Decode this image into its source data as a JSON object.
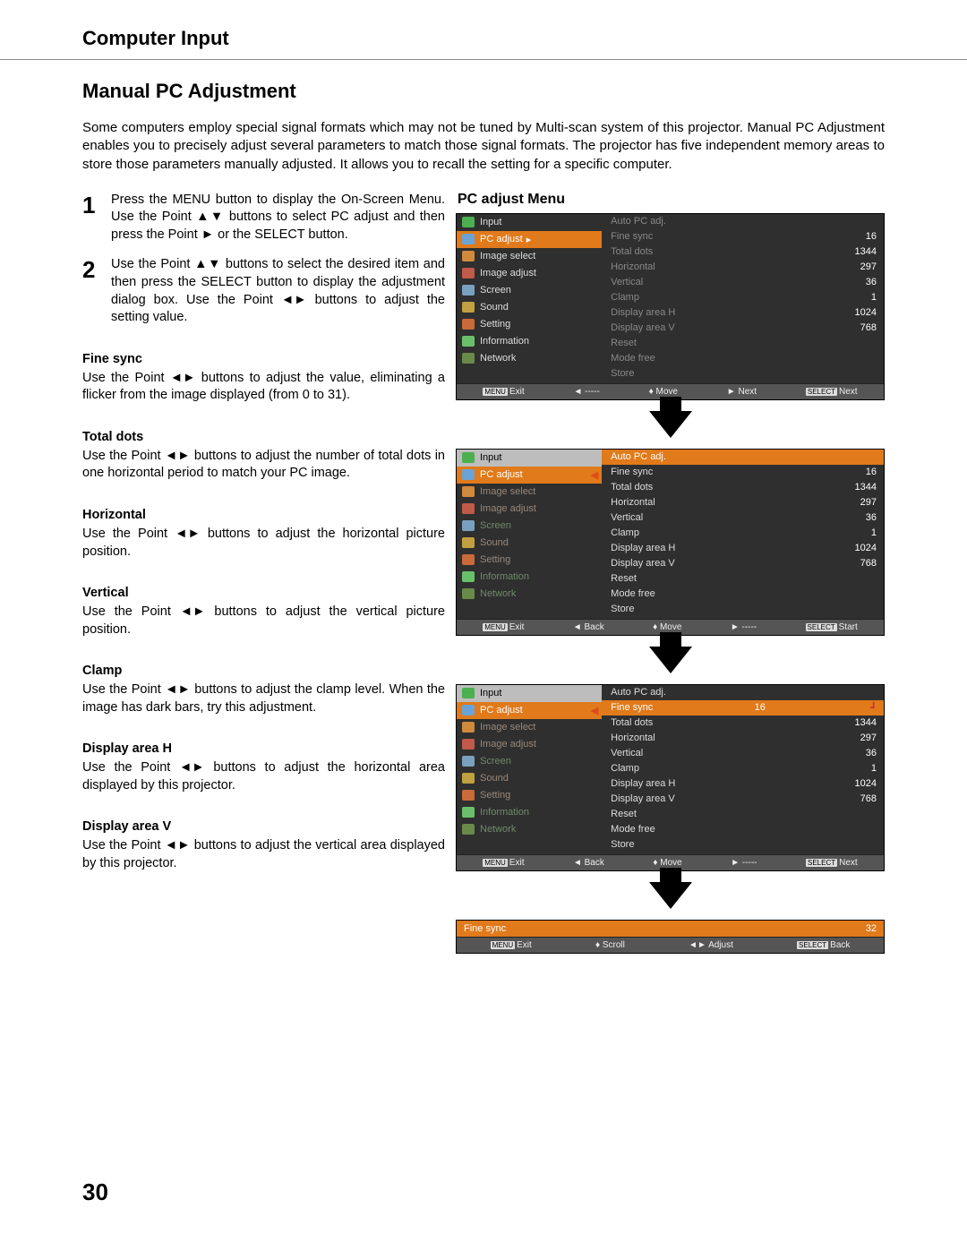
{
  "header": {
    "section": "Computer Input",
    "title": "Manual PC Adjustment"
  },
  "intro": "Some computers employ special signal formats which may not be tuned by Multi-scan system of this projector. Manual PC Adjustment enables you to precisely adjust several parameters to match those signal formats. The projector has five independent memory areas to store those parameters manually adjusted. It allows you to recall the setting for a specific computer.",
  "steps": [
    {
      "num": "1",
      "text": "Press the MENU button to display the On-Screen Menu. Use the Point ▲▼ buttons to select PC adjust and then press the Point ► or the SELECT button."
    },
    {
      "num": "2",
      "text": "Use the Point ▲▼ buttons to select  the desired item and then press the SELECT button to display the adjustment dialog box. Use the Point ◄► buttons to adjust the setting value."
    }
  ],
  "adjustments": [
    {
      "name": "Fine sync",
      "desc": "Use the Point ◄► buttons to adjust the value, eliminating a flicker from the image displayed (from 0 to 31)."
    },
    {
      "name": "Total dots",
      "desc": "Use the Point ◄► buttons to adjust the number of total dots in one horizontal period to match your PC image."
    },
    {
      "name": "Horizontal",
      "desc": "Use the Point ◄► buttons to adjust the horizontal picture position."
    },
    {
      "name": "Vertical",
      "desc": "Use the Point ◄► buttons to adjust the vertical picture position."
    },
    {
      "name": "Clamp",
      "desc": "Use the Point ◄► buttons to adjust the clamp level. When the image has dark bars, try this adjustment."
    },
    {
      "name": "Display area H",
      "desc": "Use the Point ◄► buttons to adjust the horizontal area displayed by this projector."
    },
    {
      "name": "Display area V",
      "desc": "Use the Point ◄► buttons to adjust the vertical area displayed by this projector."
    }
  ],
  "right_title": "PC adjust Menu",
  "sidebar_items": [
    {
      "label": "Input",
      "ico": "b-in"
    },
    {
      "label": "PC adjust",
      "ico": "b-pc"
    },
    {
      "label": "Image select",
      "ico": "b-is"
    },
    {
      "label": "Image adjust",
      "ico": "b-ia"
    },
    {
      "label": "Screen",
      "ico": "b-sc"
    },
    {
      "label": "Sound",
      "ico": "b-so"
    },
    {
      "label": "Setting",
      "ico": "b-se"
    },
    {
      "label": "Information",
      "ico": "b-if"
    },
    {
      "label": "Network",
      "ico": "b-nw"
    }
  ],
  "pc_menu": {
    "autopc": "Auto PC adj.",
    "rows": [
      {
        "label": "Fine sync",
        "value": "16"
      },
      {
        "label": "Total dots",
        "value": "1344"
      },
      {
        "label": "Horizontal",
        "value": "297"
      },
      {
        "label": "Vertical",
        "value": "36"
      },
      {
        "label": "Clamp",
        "value": "1"
      },
      {
        "label": "Display area H",
        "value": "1024"
      },
      {
        "label": "Display area V",
        "value": "768"
      },
      {
        "label": "Reset",
        "value": ""
      },
      {
        "label": "Mode free",
        "value": ""
      },
      {
        "label": "Store",
        "value": ""
      }
    ]
  },
  "footers": {
    "f1": {
      "a": "Exit",
      "b": "◄ -----",
      "c": "♦ Move",
      "d": "► Next",
      "e": "Next"
    },
    "f2": {
      "a": "Exit",
      "b": "◄ Back",
      "c": "♦ Move",
      "d": "► -----",
      "e": "Start"
    },
    "f3": {
      "a": "Exit",
      "b": "◄ Back",
      "c": "♦ Move",
      "d": "► -----",
      "e": "Next"
    },
    "f4": {
      "a": "Exit",
      "b": "♦ Scroll",
      "c": "◄► Adjust",
      "d": "Back"
    }
  },
  "slider": {
    "label": "Fine sync",
    "value": "32"
  },
  "page_number": "30",
  "kb": {
    "menu": "MENU",
    "select": "SELECT"
  }
}
